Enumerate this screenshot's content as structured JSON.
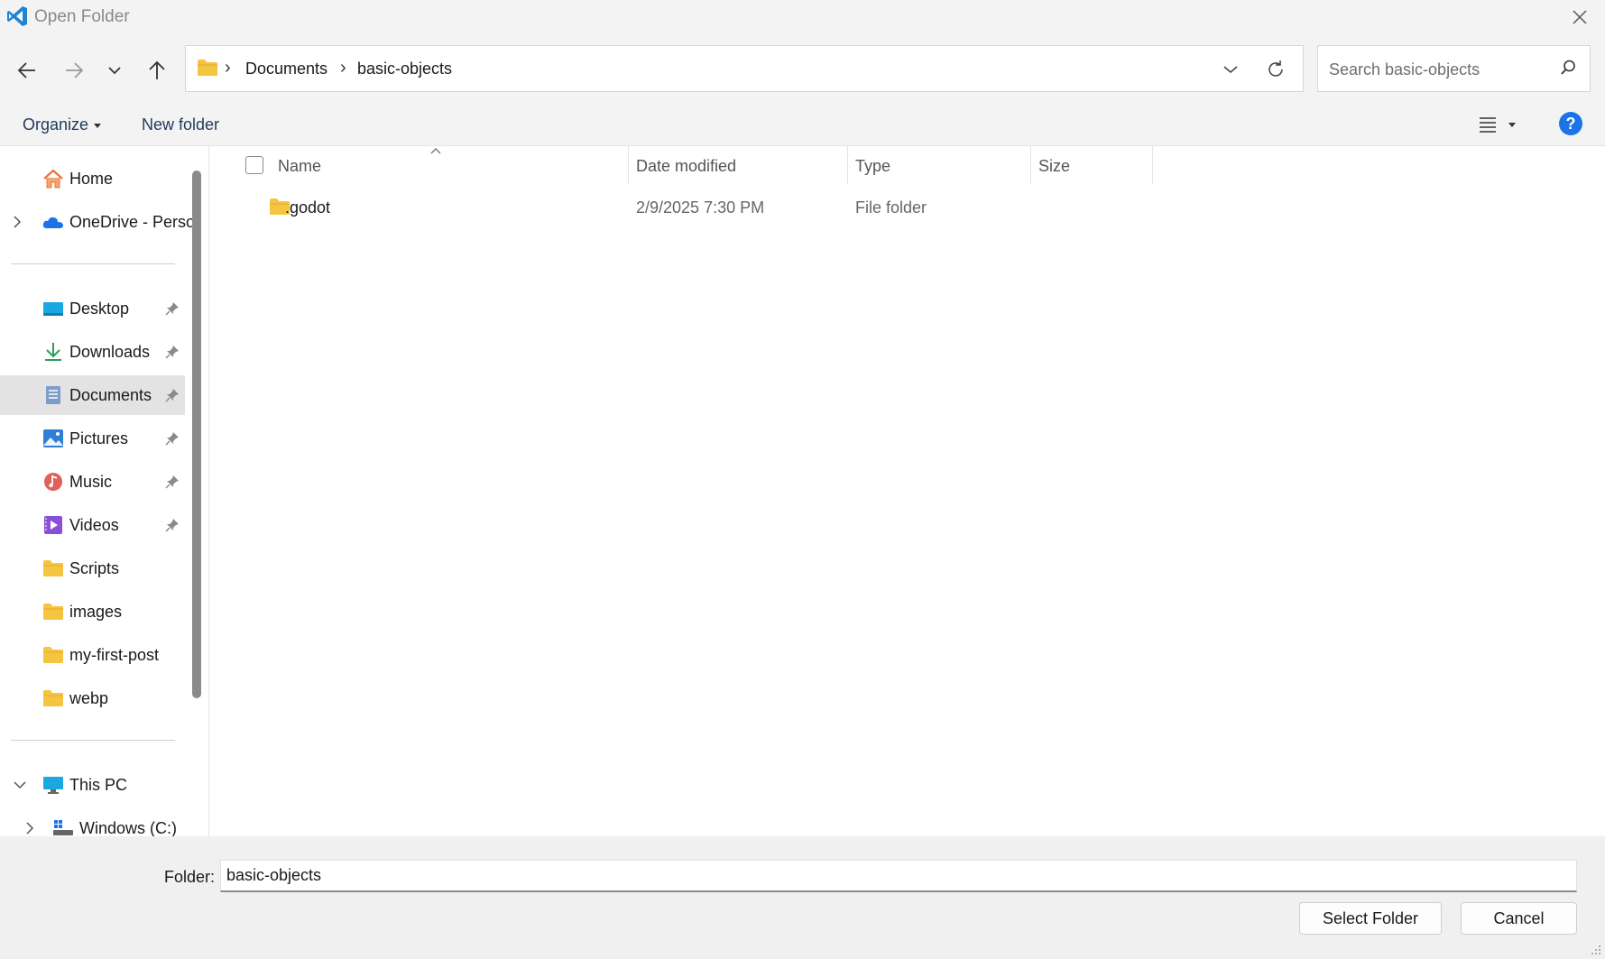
{
  "window": {
    "title": "Open Folder"
  },
  "address": {
    "crumbs": [
      "Documents",
      "basic-objects"
    ],
    "search_placeholder": "Search basic-objects"
  },
  "commands": {
    "organize": "Organize",
    "new_folder": "New folder"
  },
  "nav": {
    "items": [
      {
        "label": "Home",
        "icon": "home-icon"
      },
      {
        "label": "OneDrive - Perso",
        "icon": "onedrive-icon"
      },
      {
        "label": "Desktop",
        "icon": "desktop-icon"
      },
      {
        "label": "Downloads",
        "icon": "downloads-icon"
      },
      {
        "label": "Documents",
        "icon": "documents-icon"
      },
      {
        "label": "Pictures",
        "icon": "pictures-icon"
      },
      {
        "label": "Music",
        "icon": "music-icon"
      },
      {
        "label": "Videos",
        "icon": "videos-icon"
      },
      {
        "label": "Scripts",
        "icon": "folder-icon"
      },
      {
        "label": "images",
        "icon": "folder-icon"
      },
      {
        "label": "my-first-post",
        "icon": "folder-icon"
      },
      {
        "label": "webp",
        "icon": "folder-icon"
      },
      {
        "label": "This PC",
        "icon": "pc-icon"
      },
      {
        "label": "Windows (C:)",
        "icon": "drive-icon"
      }
    ],
    "selected": "Documents"
  },
  "columns": {
    "name": "Name",
    "date": "Date modified",
    "type": "Type",
    "size": "Size"
  },
  "files": [
    {
      "name": ".godot",
      "date": "2/9/2025 7:30 PM",
      "type": "File folder",
      "size": ""
    }
  ],
  "footer": {
    "folder_label": "Folder:",
    "folder_value": "basic-objects",
    "select_button": "Select Folder",
    "cancel_button": "Cancel"
  },
  "colors": {
    "accent": "#1a73e8",
    "folder": "#f5c542",
    "selected_bg": "#e3e3e3"
  }
}
